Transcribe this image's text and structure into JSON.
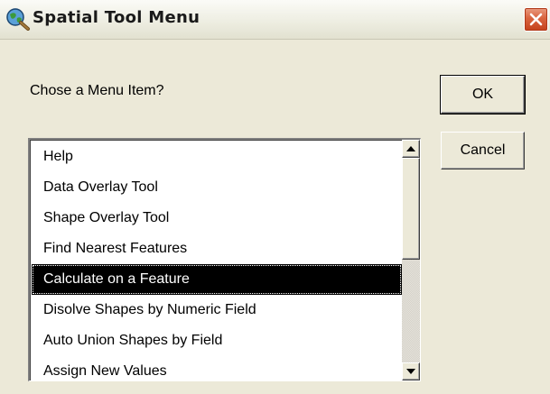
{
  "window": {
    "title": "Spatial Tool Menu",
    "icon": "globe-magnifier-icon",
    "close_icon": "close-icon",
    "close_color": "#d9643f"
  },
  "dialog": {
    "prompt": "Chose a Menu Item?",
    "ok_label": "OK",
    "cancel_label": "Cancel"
  },
  "menu_list": {
    "items": [
      "Help",
      "Data Overlay Tool",
      "Shape Overlay Tool",
      "Find Nearest Features",
      "Calculate on a Feature",
      "Disolve Shapes by Numeric Field",
      "Auto Union Shapes by Field",
      "Assign New Values"
    ],
    "selected_index": 4,
    "scroll_up_icon": "up-arrow-icon",
    "scroll_down_icon": "down-arrow-icon"
  }
}
